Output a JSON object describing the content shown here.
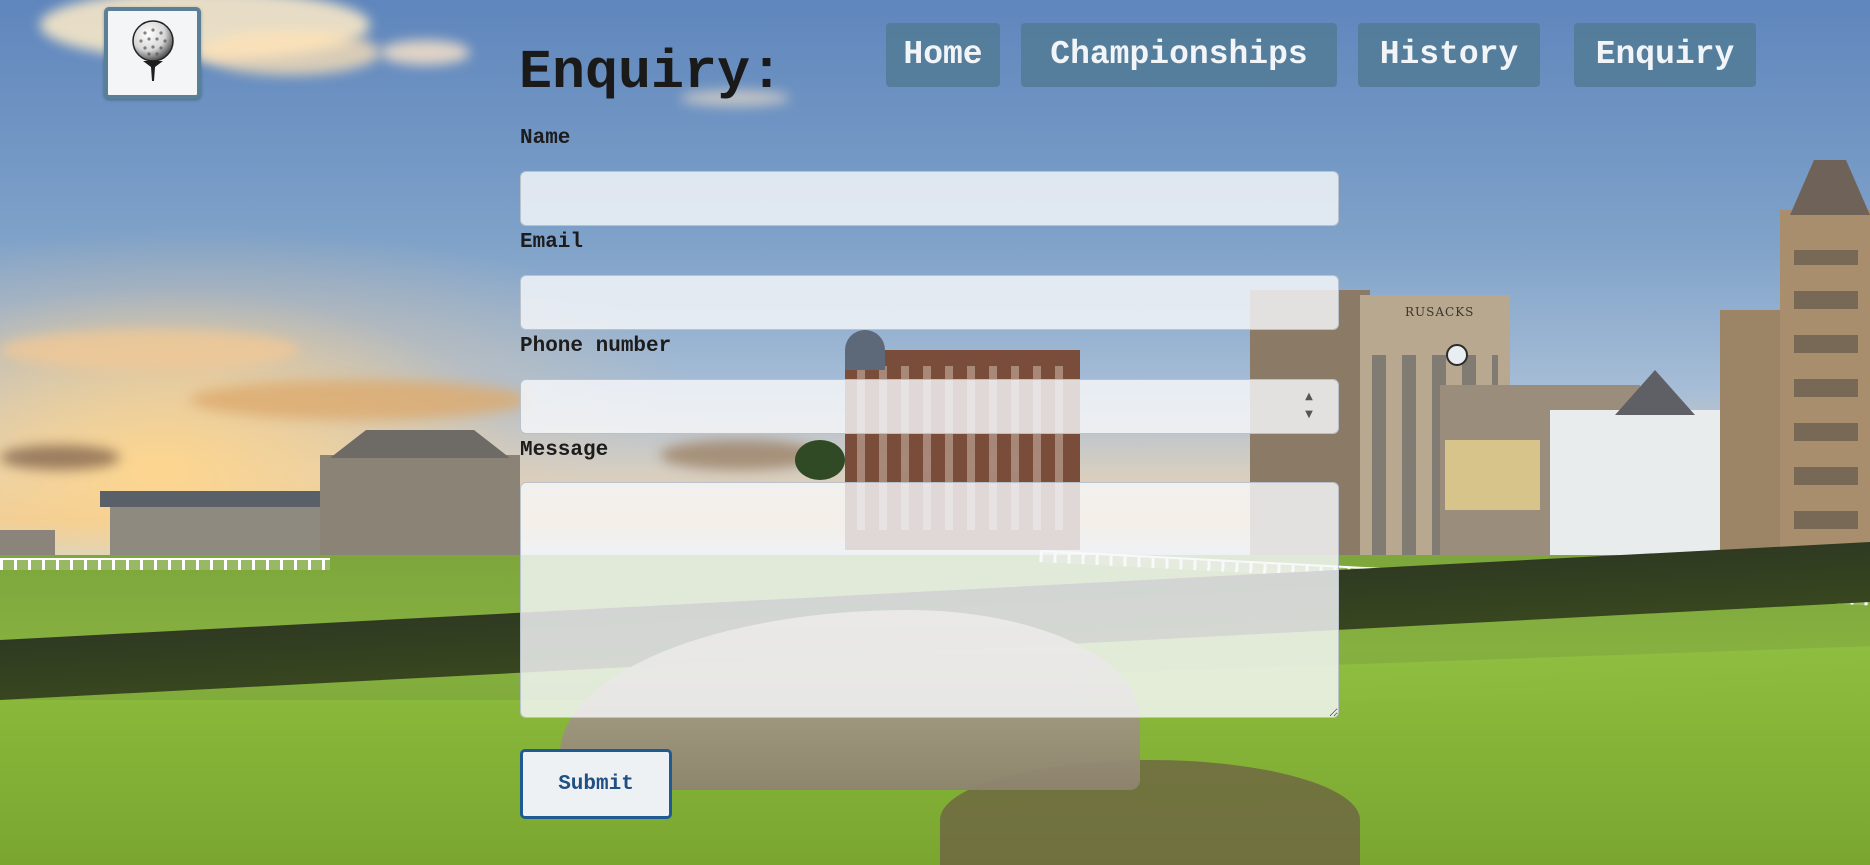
{
  "logo": {
    "icon": "golf-ball-on-tee-icon"
  },
  "nav": {
    "items": [
      {
        "label": "Home"
      },
      {
        "label": "Championships"
      },
      {
        "label": "History"
      },
      {
        "label": "Enquiry"
      }
    ]
  },
  "form": {
    "heading": "Enquiry:",
    "name": {
      "label": "Name",
      "value": "",
      "placeholder": ""
    },
    "email": {
      "label": "Email",
      "value": "",
      "placeholder": ""
    },
    "phone": {
      "label": "Phone number",
      "value": "",
      "placeholder": ""
    },
    "message": {
      "label": "Message",
      "value": "",
      "placeholder": ""
    },
    "submit_label": "Submit"
  },
  "background": {
    "icon": "golf-course-town-photo"
  },
  "colors": {
    "nav_bg": "#527c96",
    "submit_border": "#1f5a92",
    "heading_text": "#1a1a1a"
  }
}
